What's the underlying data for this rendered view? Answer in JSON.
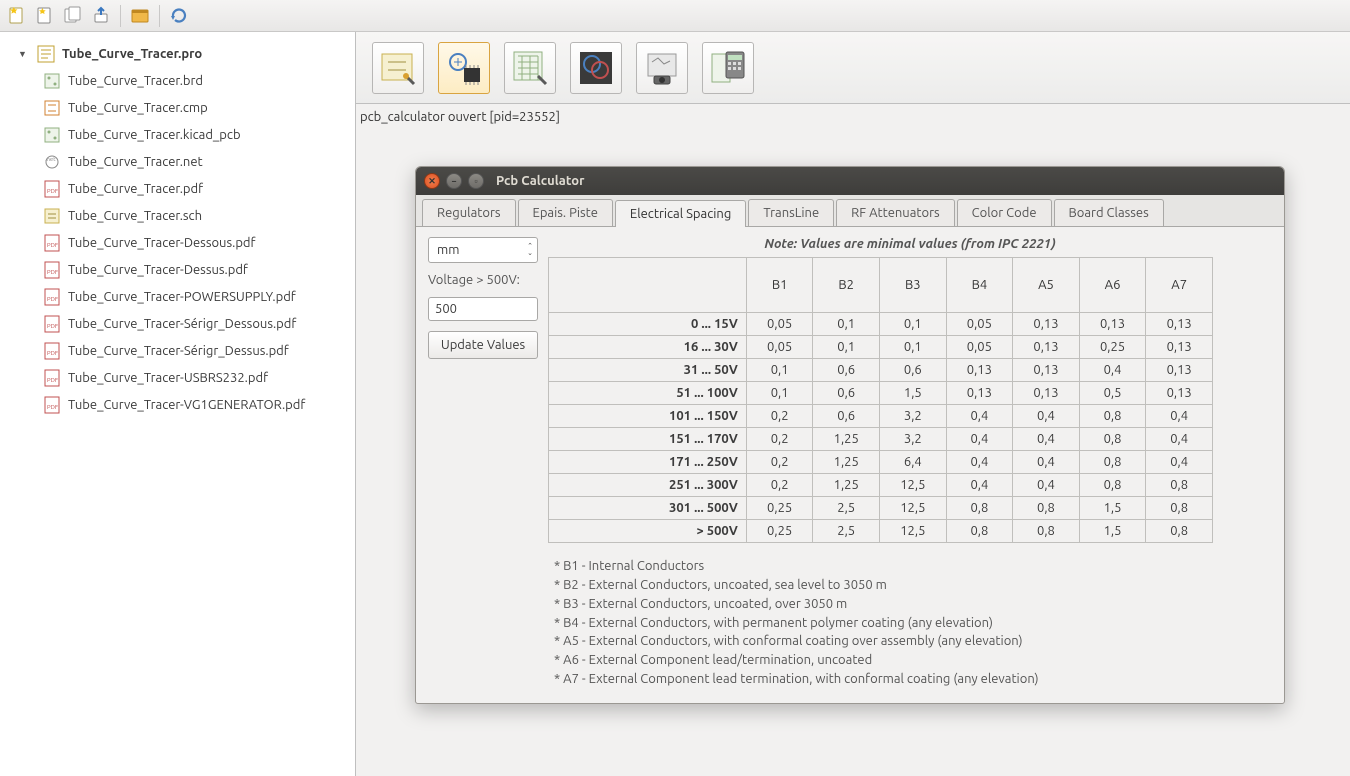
{
  "toolbar_icons": [
    "new-icon",
    "new-star-icon",
    "copy-icon",
    "export-icon",
    "window-icon",
    "refresh-icon"
  ],
  "tree": {
    "root": "Tube_Curve_Tracer.pro",
    "children": [
      "Tube_Curve_Tracer.brd",
      "Tube_Curve_Tracer.cmp",
      "Tube_Curve_Tracer.kicad_pcb",
      "Tube_Curve_Tracer.net",
      "Tube_Curve_Tracer.pdf",
      "Tube_Curve_Tracer.sch",
      "Tube_Curve_Tracer-Dessous.pdf",
      "Tube_Curve_Tracer-Dessus.pdf",
      "Tube_Curve_Tracer-POWERSUPPLY.pdf",
      "Tube_Curve_Tracer-Sérigr_Dessous.pdf",
      "Tube_Curve_Tracer-Sérigr_Dessus.pdf",
      "Tube_Curve_Tracer-USBRS232.pdf",
      "Tube_Curve_Tracer-VG1GENERATOR.pdf"
    ]
  },
  "status": "pcb_calculator ouvert [pid=23552]",
  "dialog": {
    "title": "Pcb Calculator",
    "tabs": [
      "Regulators",
      "Epais. Piste",
      "Electrical Spacing",
      "TransLine",
      "RF Attenuators",
      "Color Code",
      "Board Classes"
    ],
    "active_tab": 2,
    "unit": "mm",
    "voltage_label": "Voltage > 500V:",
    "voltage_value": "500",
    "update_button": "Update Values",
    "note": "Note: Values are minimal values (from IPC 2221)",
    "columns": [
      "",
      "B1",
      "B2",
      "B3",
      "B4",
      "A5",
      "A6",
      "A7"
    ],
    "rows": [
      [
        "0 ... 15V",
        "0,05",
        "0,1",
        "0,1",
        "0,05",
        "0,13",
        "0,13",
        "0,13"
      ],
      [
        "16 ... 30V",
        "0,05",
        "0,1",
        "0,1",
        "0,05",
        "0,13",
        "0,25",
        "0,13"
      ],
      [
        "31 ... 50V",
        "0,1",
        "0,6",
        "0,6",
        "0,13",
        "0,13",
        "0,4",
        "0,13"
      ],
      [
        "51 ... 100V",
        "0,1",
        "0,6",
        "1,5",
        "0,13",
        "0,13",
        "0,5",
        "0,13"
      ],
      [
        "101 ... 150V",
        "0,2",
        "0,6",
        "3,2",
        "0,4",
        "0,4",
        "0,8",
        "0,4"
      ],
      [
        "151 ... 170V",
        "0,2",
        "1,25",
        "3,2",
        "0,4",
        "0,4",
        "0,8",
        "0,4"
      ],
      [
        "171 ... 250V",
        "0,2",
        "1,25",
        "6,4",
        "0,4",
        "0,4",
        "0,8",
        "0,4"
      ],
      [
        "251 ... 300V",
        "0,2",
        "1,25",
        "12,5",
        "0,4",
        "0,4",
        "0,8",
        "0,8"
      ],
      [
        "301 ... 500V",
        "0,25",
        "2,5",
        "12,5",
        "0,8",
        "0,8",
        "1,5",
        "0,8"
      ],
      [
        "> 500V",
        "0,25",
        "2,5",
        "12,5",
        "0,8",
        "0,8",
        "1,5",
        "0,8"
      ]
    ],
    "legend": [
      "*  B1 - Internal Conductors",
      "*  B2 - External Conductors, uncoated, sea level to 3050 m",
      "*  B3 - External Conductors, uncoated, over 3050 m",
      "*  B4 - External Conductors, with permanent polymer coating (any elevation)",
      "*  A5 - External Conductors, with conformal coating over assembly (any elevation)",
      "*  A6 - External Component lead/termination, uncoated",
      "*  A7 - External Component lead termination, with conformal coating (any elevation)"
    ]
  }
}
